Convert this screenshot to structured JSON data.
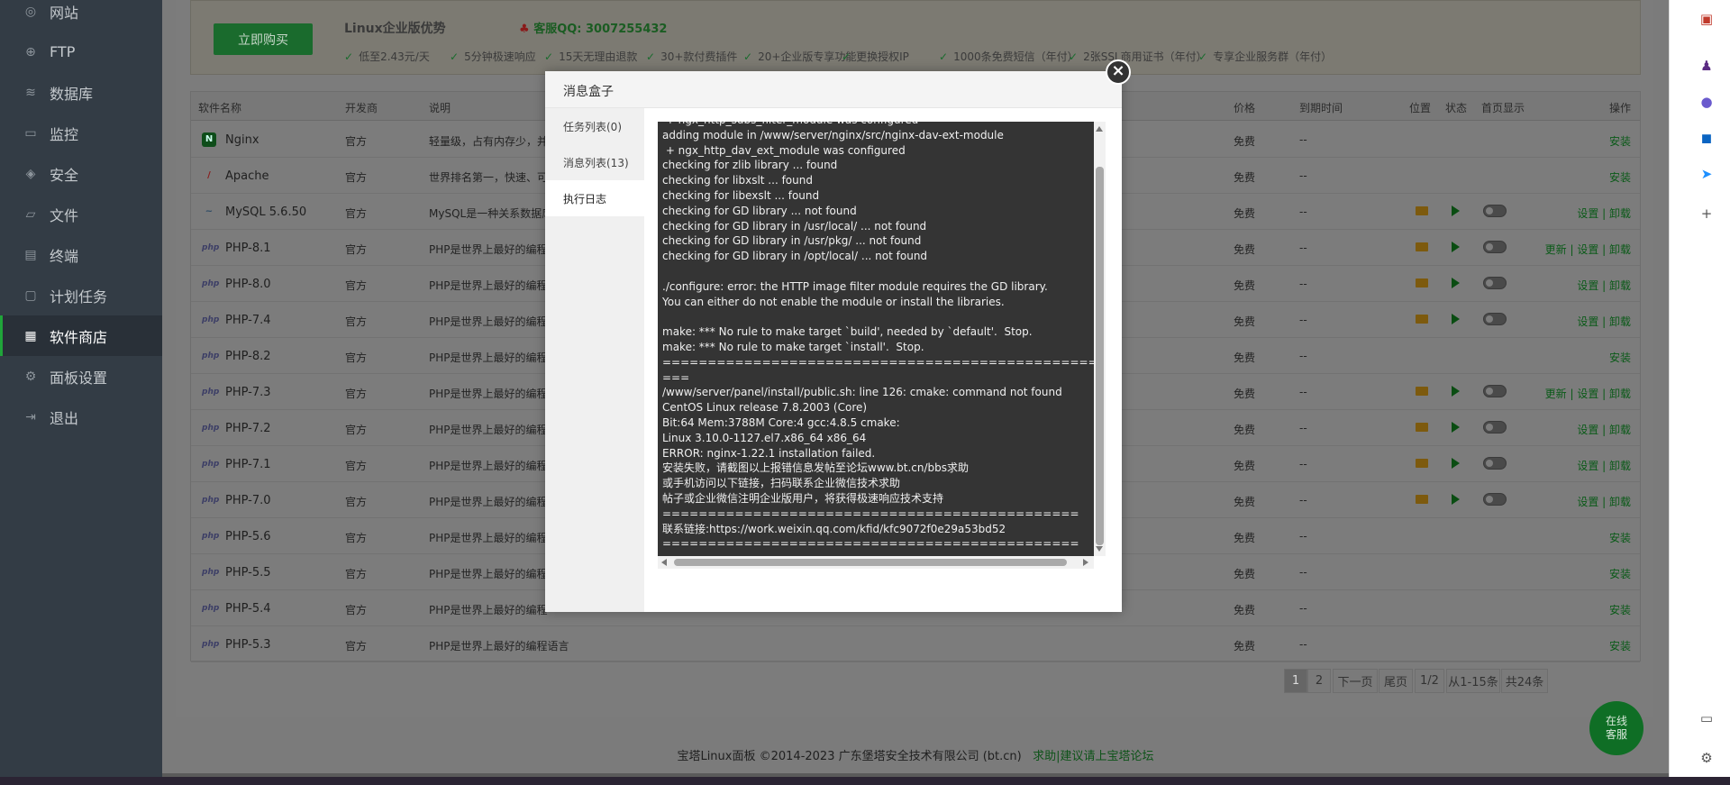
{
  "sidebar": {
    "items": [
      {
        "label": "网站",
        "icon": "globe-icon",
        "glyph": "◎"
      },
      {
        "label": "FTP",
        "icon": "ftp-icon",
        "glyph": "⊕"
      },
      {
        "label": "数据库",
        "icon": "database-icon",
        "glyph": "≋"
      },
      {
        "label": "监控",
        "icon": "monitor-icon",
        "glyph": "▭"
      },
      {
        "label": "安全",
        "icon": "shield-icon",
        "glyph": "◈"
      },
      {
        "label": "文件",
        "icon": "folder-icon",
        "glyph": "▱"
      },
      {
        "label": "终端",
        "icon": "terminal-icon",
        "glyph": "▤"
      },
      {
        "label": "计划任务",
        "icon": "clock-icon",
        "glyph": "▢"
      },
      {
        "label": "软件商店",
        "icon": "app-store-icon",
        "glyph": "▦"
      },
      {
        "label": "面板设置",
        "icon": "settings-icon",
        "glyph": "⚙"
      },
      {
        "label": "退出",
        "icon": "logout-icon",
        "glyph": "⇥"
      }
    ],
    "active_index": 8
  },
  "promo": {
    "buy_label": "立即购买",
    "title": "Linux企业版优势",
    "qq": "客服QQ: 3007255432",
    "features": [
      "低至2.43元/天",
      "5分钟极速响应",
      "15天无理由退款",
      "30+款付费插件",
      "20+企业版专享功能",
      "更换授权IP",
      "1000条免费短信（年付）",
      "2张SSL商用证书（年付）",
      "专享企业服务群（年付）"
    ]
  },
  "table": {
    "headers": {
      "name": "软件名称",
      "vendor": "开发商",
      "desc": "说明",
      "price": "价格",
      "expire": "到期时间",
      "location": "位置",
      "status": "状态",
      "home": "首页显示",
      "action": "操作"
    },
    "rows": [
      {
        "name": "Nginx",
        "vendor": "官方",
        "desc": "轻量级，占有内存少，并",
        "price": "免费",
        "expire": "--",
        "action": "安装",
        "logo": "N",
        "installed": false
      },
      {
        "name": "Apache",
        "vendor": "官方",
        "desc": "世界排名第一，快速、可",
        "price": "免费",
        "expire": "--",
        "action": "安装",
        "logo": "/",
        "installed": false
      },
      {
        "name": "MySQL 5.6.50",
        "vendor": "官方",
        "desc": "MySQL是一种关系数据库",
        "price": "免费",
        "expire": "--",
        "action": "设置 | 卸载",
        "logo": "~",
        "installed": true
      },
      {
        "name": "PHP-8.1",
        "vendor": "官方",
        "desc": "PHP是世界上最好的编程",
        "price": "免费",
        "expire": "--",
        "action": "更新 | 设置 | 卸载",
        "logo": "php",
        "installed": true
      },
      {
        "name": "PHP-8.0",
        "vendor": "官方",
        "desc": "PHP是世界上最好的编程",
        "price": "免费",
        "expire": "--",
        "action": "设置 | 卸载",
        "logo": "php",
        "installed": true
      },
      {
        "name": "PHP-7.4",
        "vendor": "官方",
        "desc": "PHP是世界上最好的编程",
        "price": "免费",
        "expire": "--",
        "action": "设置 | 卸载",
        "logo": "php",
        "installed": true
      },
      {
        "name": "PHP-8.2",
        "vendor": "官方",
        "desc": "PHP是世界上最好的编程",
        "price": "免费",
        "expire": "--",
        "action": "安装",
        "logo": "php",
        "installed": false
      },
      {
        "name": "PHP-7.3",
        "vendor": "官方",
        "desc": "PHP是世界上最好的编程",
        "price": "免费",
        "expire": "--",
        "action": "更新 | 设置 | 卸载",
        "logo": "php",
        "installed": true
      },
      {
        "name": "PHP-7.2",
        "vendor": "官方",
        "desc": "PHP是世界上最好的编程",
        "price": "免费",
        "expire": "--",
        "action": "设置 | 卸载",
        "logo": "php",
        "installed": true
      },
      {
        "name": "PHP-7.1",
        "vendor": "官方",
        "desc": "PHP是世界上最好的编程",
        "price": "免费",
        "expire": "--",
        "action": "设置 | 卸载",
        "logo": "php",
        "installed": true
      },
      {
        "name": "PHP-7.0",
        "vendor": "官方",
        "desc": "PHP是世界上最好的编程",
        "price": "免费",
        "expire": "--",
        "action": "设置 | 卸载",
        "logo": "php",
        "installed": true
      },
      {
        "name": "PHP-5.6",
        "vendor": "官方",
        "desc": "PHP是世界上最好的编程",
        "price": "免费",
        "expire": "--",
        "action": "安装",
        "logo": "php",
        "installed": false
      },
      {
        "name": "PHP-5.5",
        "vendor": "官方",
        "desc": "PHP是世界上最好的编程",
        "price": "免费",
        "expire": "--",
        "action": "安装",
        "logo": "php",
        "installed": false
      },
      {
        "name": "PHP-5.4",
        "vendor": "官方",
        "desc": "PHP是世界上最好的编程",
        "price": "免费",
        "expire": "--",
        "action": "安装",
        "logo": "php",
        "installed": false
      },
      {
        "name": "PHP-5.3",
        "vendor": "官方",
        "desc": "PHP是世界上最好的编程语言",
        "price": "免费",
        "expire": "--",
        "action": "安装",
        "logo": "php",
        "installed": false
      }
    ]
  },
  "pagination": {
    "items": [
      "1",
      "2",
      "下一页",
      "尾页",
      "1/2",
      "从1-15条",
      "共24条"
    ],
    "current": "1"
  },
  "footer": {
    "copyright": "宝塔Linux面板 ©2014-2023 广东堡塔安全技术有限公司 (bt.cn)",
    "link": "求助|建议请上宝塔论坛"
  },
  "online_service": "在线\n客服",
  "modal": {
    "title": "消息盒子",
    "close_glyph": "×",
    "nav": [
      "任务列表(0)",
      "消息列表(13)",
      "执行日志"
    ],
    "nav_active": 2,
    "log": " + ngx_http_subs_filter_module was configured\nadding module in /www/server/nginx/src/nginx-dav-ext-module\n + ngx_http_dav_ext_module was configured\nchecking for zlib library ... found\nchecking for libxslt ... found\nchecking for libexslt ... found\nchecking for GD library ... not found\nchecking for GD library in /usr/local/ ... not found\nchecking for GD library in /usr/pkg/ ... not found\nchecking for GD library in /opt/local/ ... not found\n\n./configure: error: the HTTP image filter module requires the GD library.\nYou can either do not enable the module or install the libraries.\n\nmake: *** No rule to make target `build', needed by `default'.  Stop.\nmake: *** No rule to make target `install'.  Stop.\n=====================================================\n===\n/www/server/panel/install/public.sh: line 126: cmake: command not found\nCentOS Linux release 7.8.2003 (Core)\nBit:64 Mem:3788M Core:4 gcc:4.8.5 cmake:\nLinux 3.10.0-1127.el7.x86_64 x86_64\nERROR: nginx-1.22.1 installation failed.\n安装失败，请截图以上报错信息发帖至论坛www.bt.cn/bbs求助\n或手机访问以下链接，扫码联系企业微信技术求助\n帖子或企业微信注明企业版用户，将获得极速响应技术支持\n==============================================\n联系链接:https://work.weixin.qq.com/kfid/kfc9072f0e29a53bd52\n=============================================="
  },
  "rightbar": {
    "icons": [
      {
        "name": "toolbox-icon",
        "glyph": "▣",
        "color": "#c0392b"
      },
      {
        "name": "person-icon",
        "glyph": "♟",
        "color": "#5b2c83"
      },
      {
        "name": "copilot-icon",
        "glyph": "●",
        "color": "#6a5acd"
      },
      {
        "name": "outlook-icon",
        "glyph": "◼",
        "color": "#0a64c2"
      },
      {
        "name": "send-icon",
        "glyph": "➤",
        "color": "#1e90ff"
      },
      {
        "name": "add-icon",
        "glyph": "+",
        "color": "#555555"
      }
    ],
    "bottom_icons": [
      {
        "name": "screen-icon",
        "glyph": "▭",
        "color": "#555555"
      },
      {
        "name": "gear-icon",
        "glyph": "⚙",
        "color": "#555555"
      }
    ]
  }
}
